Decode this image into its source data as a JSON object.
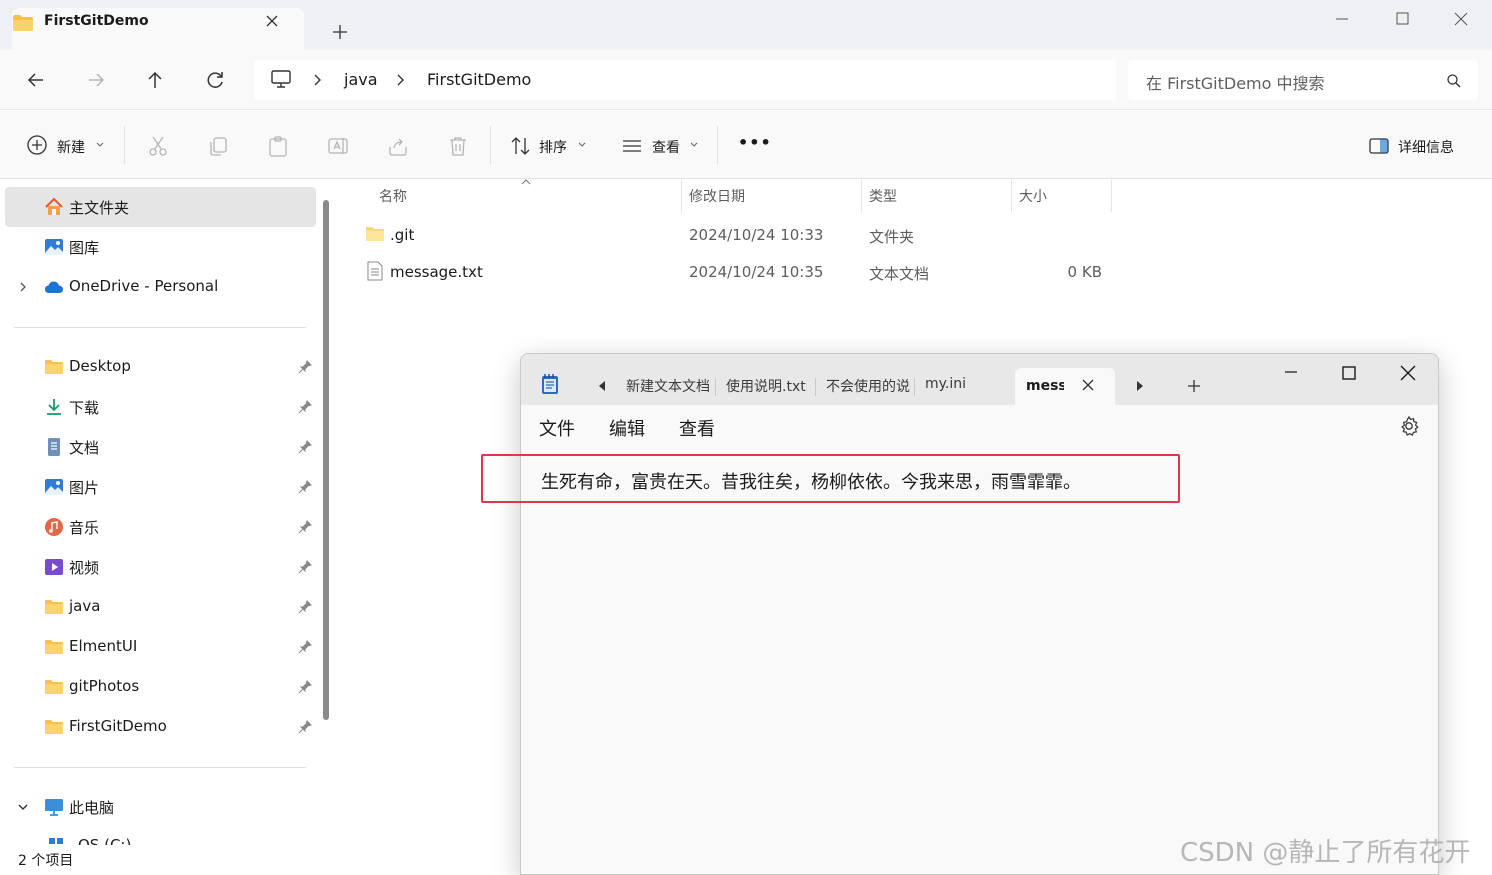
{
  "window": {
    "tab_title": "FirstGitDemo",
    "icons": {
      "folder": "folder-icon",
      "close": "close-icon",
      "new_tab": "plus-icon",
      "minimize": "minimize-icon",
      "maximize": "maximize-icon"
    }
  },
  "address": {
    "crumbs": [
      "java",
      "FirstGitDemo"
    ],
    "search_placeholder": "在 FirstGitDemo 中搜索"
  },
  "toolbar": {
    "new_label": "新建",
    "sort_label": "排序",
    "view_label": "查看",
    "more_label": "•••",
    "details_label": "详细信息"
  },
  "nav": {
    "items": [
      {
        "label": "主文件夹",
        "icon": "home-icon"
      },
      {
        "label": "图库",
        "icon": "gallery-icon"
      },
      {
        "label": "OneDrive - Personal",
        "icon": "cloud-icon"
      },
      {
        "label": "Desktop",
        "icon": "folder-icon"
      },
      {
        "label": "下载",
        "icon": "download-icon"
      },
      {
        "label": "文档",
        "icon": "document-icon"
      },
      {
        "label": "图片",
        "icon": "pictures-icon"
      },
      {
        "label": "音乐",
        "icon": "music-icon"
      },
      {
        "label": "视频",
        "icon": "video-icon"
      },
      {
        "label": "java",
        "icon": "folder-icon"
      },
      {
        "label": "ElmentUI",
        "icon": "folder-icon"
      },
      {
        "label": "gitPhotos",
        "icon": "folder-icon"
      },
      {
        "label": "FirstGitDemo",
        "icon": "folder-icon"
      },
      {
        "label": "此电脑",
        "icon": "pc-icon"
      },
      {
        "label": "OS (C:)",
        "icon": "drive-icon"
      }
    ]
  },
  "files": {
    "headers": {
      "name": "名称",
      "date": "修改日期",
      "type": "类型",
      "size": "大小"
    },
    "rows": [
      {
        "name": ".git",
        "date": "2024/10/24 10:33",
        "type": "文件夹",
        "size": ""
      },
      {
        "name": "message.txt",
        "date": "2024/10/24 10:35",
        "type": "文本文档",
        "size": "0 KB"
      }
    ]
  },
  "status": {
    "count": "2 个项目"
  },
  "notepad": {
    "tabs": [
      "新建文本文档",
      "使用说明.txt",
      "不会使用的说明",
      "my.ini",
      "message.txt"
    ],
    "menu": {
      "file": "文件",
      "edit": "编辑",
      "view": "查看"
    },
    "content": "生死有命，富贵在天。昔我往矣，杨柳依依。今我来思，雨雪霏霏。"
  },
  "watermark": "CSDN @静止了所有花开",
  "colors": {
    "accent": "#0067c0",
    "folder": "#f8c24a",
    "highlight": "#e0354a",
    "notepad_icon": "#2a6ac8"
  }
}
